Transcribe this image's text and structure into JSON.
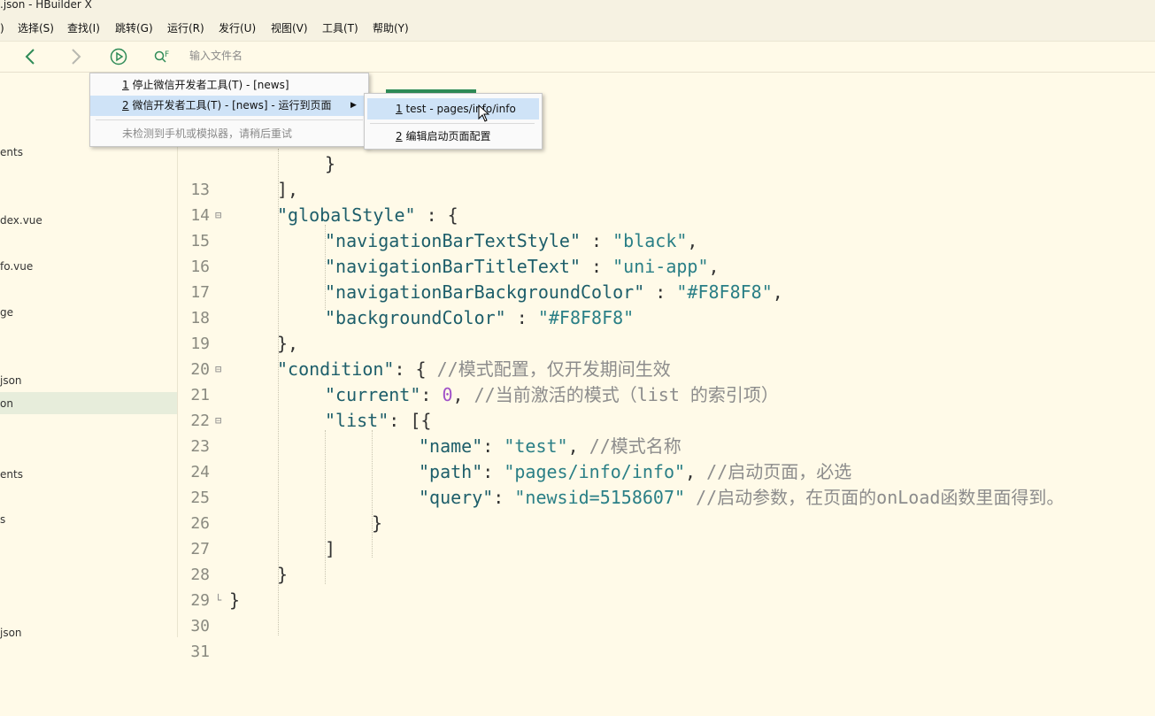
{
  "window": {
    "title": ".json - HBuilder X"
  },
  "menu": [
    {
      "label": ")"
    },
    {
      "label": "选择(S)"
    },
    {
      "label": "查找(I)"
    },
    {
      "label": "跳转(G)"
    },
    {
      "label": "运行(R)"
    },
    {
      "label": "发行(U)"
    },
    {
      "label": "视图(V)"
    },
    {
      "label": "工具(T)"
    },
    {
      "label": "帮助(Y)"
    }
  ],
  "toolbar": {
    "search_placeholder": "输入文件名",
    "search_icon_label": "F"
  },
  "sidebar": {
    "items": [
      {
        "label": "ents"
      },
      {
        "label": "dex.vue"
      },
      {
        "label": "fo.vue"
      },
      {
        "label": "ge"
      },
      {
        "label": "json"
      },
      {
        "label": "on"
      },
      {
        "label": "ents"
      },
      {
        "label": "s"
      },
      {
        "label": "json"
      }
    ]
  },
  "run_menu": {
    "items": [
      {
        "num": "1",
        "label": " 停止微信开发者工具(T) - [news]"
      },
      {
        "num": "2",
        "label": " 微信开发者工具(T) - [news] - 运行到页面"
      },
      {
        "label": "未检测到手机或模拟器，请稍后重试"
      }
    ]
  },
  "submenu": {
    "items": [
      {
        "num": "1",
        "label": " test - pages/info/info"
      },
      {
        "num": "2",
        "label": " 编辑启动页面配置"
      }
    ]
  },
  "code": {
    "l13": {
      "num": "13",
      "text": "}"
    },
    "l14": {
      "num": "14",
      "text": "],"
    },
    "l15": {
      "num": "15",
      "key": "\"globalStyle\"",
      "rest": " : {"
    },
    "l16": {
      "num": "16",
      "key": "\"navigationBarTextStyle\"",
      "sep": " : ",
      "val": "\"black\"",
      "end": ","
    },
    "l17": {
      "num": "17",
      "key": "\"navigationBarTitleText\"",
      "sep": " : ",
      "val": "\"uni-app\"",
      "end": ","
    },
    "l18": {
      "num": "18",
      "key": "\"navigationBarBackgroundColor\"",
      "sep": " : ",
      "val": "\"#F8F8F8\"",
      "end": ","
    },
    "l19": {
      "num": "19",
      "key": "\"backgroundColor\"",
      "sep": " : ",
      "val": "\"#F8F8F8\"",
      "end": ""
    },
    "l20": {
      "num": "20",
      "text": "},"
    },
    "l21": {
      "num": "21",
      "key": "\"condition\"",
      "rest": ": { ",
      "comment": "//模式配置，仅开发期间生效"
    },
    "l22": {
      "num": "22",
      "key": "\"current\"",
      "sep": ": ",
      "num_val": "0",
      "end": ", ",
      "comment": "//当前激活的模式（list 的索引项）"
    },
    "l23": {
      "num": "23",
      "key": "\"list\"",
      "rest": ": [{"
    },
    "l24": {
      "num": "24",
      "key": "\"name\"",
      "sep": ": ",
      "val": "\"test\"",
      "end": ", ",
      "comment": "//模式名称"
    },
    "l25": {
      "num": "25",
      "key": "\"path\"",
      "sep": ": ",
      "val": "\"pages/info/info\"",
      "end": ", ",
      "comment": "//启动页面，必选"
    },
    "l26": {
      "num": "26",
      "key": "\"query\"",
      "sep": ": ",
      "val": "\"newsid=5158607\"",
      "end": " ",
      "comment": "//启动参数，在页面的onLoad函数里面得到。"
    },
    "l27": {
      "num": "27",
      "text": "}"
    },
    "l28": {
      "num": "28",
      "text": "]"
    },
    "l29": {
      "num": "29",
      "text": "}"
    },
    "l30": {
      "num": "30",
      "text": "}"
    },
    "l31": {
      "num": "31",
      "text": ""
    }
  },
  "colors": {
    "background": "#fffae8",
    "key": "#1d5e6a",
    "string": "#2a7f86",
    "number": "#a050c8",
    "comment": "#8c8c8c",
    "highlight": "#cfe3f7"
  }
}
